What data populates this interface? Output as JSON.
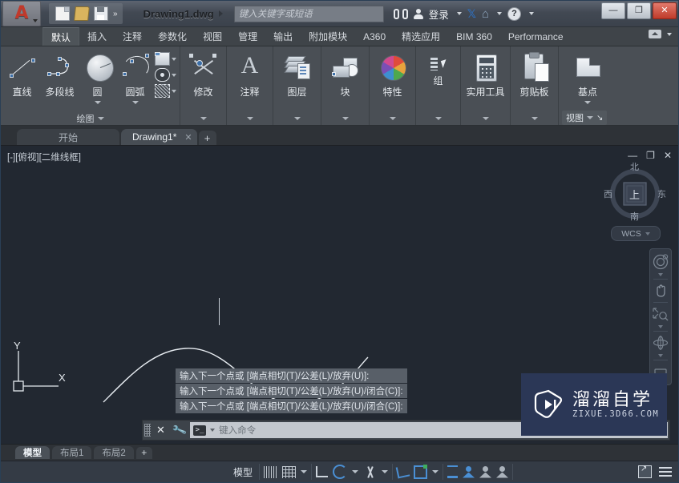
{
  "titlebar": {
    "quick_access": [
      "new-icon",
      "open-icon",
      "save-icon",
      "more-icon"
    ],
    "document_title": "Drawing1.dwg",
    "search_placeholder": "键入关键字或短语",
    "sign_in_label": "登录",
    "icons": [
      "binoculars-icon",
      "person-icon",
      "exchange-icon",
      "autodesk-icon",
      "help-icon"
    ],
    "window_buttons": {
      "minimize": "—",
      "maximize": "❐",
      "close": "✕"
    }
  },
  "ribbon_tabs": [
    {
      "label": "默认",
      "active": true
    },
    {
      "label": "插入",
      "active": false
    },
    {
      "label": "注释",
      "active": false
    },
    {
      "label": "参数化",
      "active": false
    },
    {
      "label": "视图",
      "active": false
    },
    {
      "label": "管理",
      "active": false
    },
    {
      "label": "输出",
      "active": false
    },
    {
      "label": "附加模块",
      "active": false
    },
    {
      "label": "A360",
      "active": false
    },
    {
      "label": "精选应用",
      "active": false
    },
    {
      "label": "BIM 360",
      "active": false
    },
    {
      "label": "Performance",
      "active": false
    }
  ],
  "ribbon_panels": {
    "draw": {
      "title": "绘图",
      "buttons": [
        {
          "label": "直线",
          "icon": "line-icon"
        },
        {
          "label": "多段线",
          "icon": "polyline-icon"
        },
        {
          "label": "圆",
          "icon": "circle-icon"
        },
        {
          "label": "圆弧",
          "icon": "arc-icon"
        }
      ],
      "small_buttons": [
        {
          "icon": "rectangle-icon"
        },
        {
          "icon": "ellipse-icon"
        },
        {
          "icon": "hatch-icon"
        }
      ]
    },
    "panels": [
      {
        "label": "修改",
        "icon": "modify-icon"
      },
      {
        "label": "注释",
        "icon": "annotation-icon"
      },
      {
        "label": "图层",
        "icon": "layer-icon"
      },
      {
        "label": "块",
        "icon": "block-icon"
      },
      {
        "label": "特性",
        "icon": "properties-icon"
      },
      {
        "label": "组",
        "icon": "group-icon"
      },
      {
        "label": "实用工具",
        "icon": "utilities-icon"
      },
      {
        "label": "剪贴板",
        "icon": "clipboard-icon"
      },
      {
        "label": "基点",
        "icon": "basepoint-icon"
      }
    ],
    "view_tag": "视图"
  },
  "file_tabs": [
    {
      "label": "开始",
      "active": false,
      "closable": false
    },
    {
      "label": "Drawing1*",
      "active": true,
      "closable": true,
      "close_glyph": "✕"
    }
  ],
  "file_tab_add": "+",
  "viewport": {
    "label": "[-][俯视][二维线框]",
    "window_buttons": [
      "minimize-glyph",
      "restore-glyph",
      "close-glyph"
    ],
    "minimize_glyph": "—",
    "restore_glyph": "❐",
    "close_glyph": "✕",
    "viewcube": {
      "north": "北",
      "west": "西",
      "top": "上",
      "east": "东",
      "south": "南"
    },
    "wcs_label": "WCS",
    "ucs": {
      "x_axis": "X",
      "y_axis": "Y"
    },
    "navbar_icons": [
      "steering-wheel-icon",
      "pan-hand-icon",
      "zoom-extents-icon",
      "orbit-icon",
      "show-motion-icon"
    ]
  },
  "command": {
    "history": [
      "输入下一个点或 [端点相切(T)/公差(L)/放弃(U)]:",
      "输入下一个点或 [端点相切(T)/公差(L)/放弃(U)/闭合(C)]:",
      "输入下一个点或 [端点相切(T)/公差(L)/放弃(U)/闭合(C)]:"
    ],
    "input_placeholder": "键入命令",
    "close_glyph": "✕",
    "prompt_glyph": ">_"
  },
  "layout_tabs": [
    {
      "label": "模型",
      "active": true
    },
    {
      "label": "布局1",
      "active": false
    },
    {
      "label": "布局2",
      "active": false
    }
  ],
  "layout_tab_add": "+",
  "statusbar": {
    "model_label": "模型",
    "toggles": [
      "grid-display-icon",
      "snap-mode-icon",
      "ortho-mode-icon",
      "polar-tracking-icon",
      "object-snap-icon",
      "object-snap-tracking-icon",
      "ucs-icon",
      "lineweight-icon",
      "annotation-visibility-icon",
      "annotation-scale-icon",
      "annotation-autoscale-icon"
    ],
    "right_icons": [
      "isolate-objects-icon",
      "customization-icon"
    ]
  },
  "watermark": {
    "title": "溜溜自学",
    "url": "ZIXUE.3D66.COM",
    "brand_color": "#2b3756"
  },
  "colors": {
    "canvas_bg": "#222831",
    "ribbon_bg": "#4a4f55",
    "accent_blue": "#4a8fd4",
    "spline_stroke": "#e8edf2"
  },
  "chart_data": null
}
